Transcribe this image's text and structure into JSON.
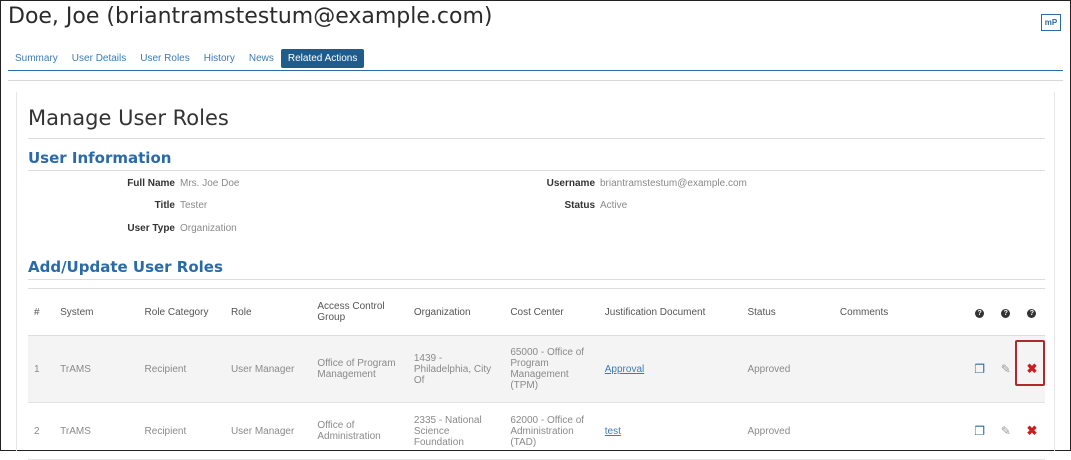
{
  "page": {
    "title": "Doe, Joe (briantramstestum@example.com)",
    "header_icon": "mP"
  },
  "tabs": [
    {
      "label": "Summary",
      "active": false
    },
    {
      "label": "User Details",
      "active": false
    },
    {
      "label": "User Roles",
      "active": false
    },
    {
      "label": "History",
      "active": false
    },
    {
      "label": "News",
      "active": false
    },
    {
      "label": "Related Actions",
      "active": true
    }
  ],
  "section_title": "Manage User Roles",
  "user_info": {
    "heading": "User Information",
    "full_name_label": "Full Name",
    "full_name": "Mrs. Joe Doe",
    "title_label": "Title",
    "title": "Tester",
    "user_type_label": "User Type",
    "user_type": "Organization",
    "username_label": "Username",
    "username": "briantramstestum@example.com",
    "status_label": "Status",
    "status": "Active"
  },
  "roles": {
    "heading": "Add/Update User Roles",
    "columns": [
      "#",
      "System",
      "Role Category",
      "Role",
      "Access Control Group",
      "Organization",
      "Cost Center",
      "Justification Document",
      "Status",
      "Comments"
    ],
    "help_icons": [
      "?",
      "?",
      "?"
    ],
    "action_glyphs": {
      "copy": "❐",
      "edit": "✎",
      "delete": "✖"
    },
    "rows": [
      {
        "num": "1",
        "system": "TrAMS",
        "role_category": "Recipient",
        "role": "User Manager",
        "access_control_group": "Office of Program Management",
        "organization": "1439 - Philadelphia, City Of",
        "cost_center": "65000 - Office of Program Management (TPM)",
        "justification": "Approval",
        "status": "Approved",
        "comments": ""
      },
      {
        "num": "2",
        "system": "TrAMS",
        "role_category": "Recipient",
        "role": "User Manager",
        "access_control_group": "Office of Administration",
        "organization": "2335 - National Science Foundation",
        "cost_center": "62000 - Office of Administration (TAD)",
        "justification": "test",
        "status": "Approved",
        "comments": ""
      }
    ]
  },
  "colors": {
    "accent": "#2a6aa8",
    "active_tab": "#1f5c8b",
    "delete": "#c81e1e",
    "highlight_box": "#b3262d"
  }
}
